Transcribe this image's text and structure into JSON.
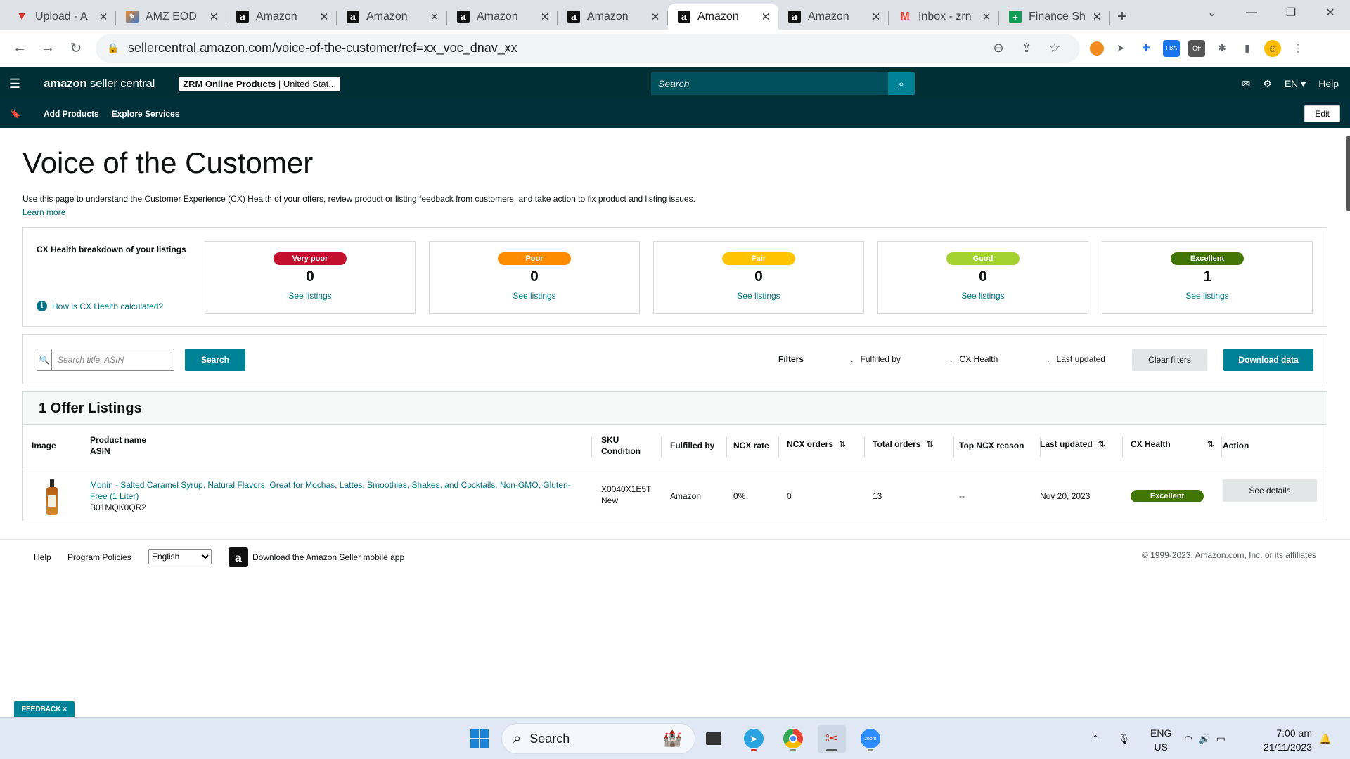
{
  "browser": {
    "tabs": [
      {
        "title": "Upload - A",
        "icon": "v-logo-icon",
        "active": false
      },
      {
        "title": "AMZ EOD",
        "icon": "amz-eod-icon",
        "active": false
      },
      {
        "title": "Amazon",
        "icon": "amazon-icon",
        "active": false
      },
      {
        "title": "Amazon",
        "icon": "amazon-icon",
        "active": false
      },
      {
        "title": "Amazon",
        "icon": "amazon-icon",
        "active": false
      },
      {
        "title": "Amazon",
        "icon": "amazon-icon",
        "active": false
      },
      {
        "title": "Amazon",
        "icon": "amazon-icon",
        "active": true
      },
      {
        "title": "Amazon",
        "icon": "amazon-icon",
        "active": false
      },
      {
        "title": "Inbox - zrn",
        "icon": "gmail-icon",
        "active": false
      },
      {
        "title": "Finance Sh",
        "icon": "sheets-icon",
        "active": false
      }
    ],
    "url": "sellercentral.amazon.com/voice-of-the-customer/ref=xx_voc_dnav_xx"
  },
  "header": {
    "logo_bold": "amazon",
    "logo_rest": " seller central",
    "account_bold": "ZRM Online Products",
    "account_rest": " | United Stat...",
    "search_placeholder": "Search",
    "language": "EN",
    "help": "Help"
  },
  "subnav": {
    "links": [
      "Add Products",
      "Explore Services"
    ],
    "edit": "Edit"
  },
  "page": {
    "title": "Voice of the Customer",
    "intro": "Use this page to understand the Customer Experience (CX) Health of your offers, review product or listing feedback from customers, and take action to fix product and listing issues.",
    "learn_more": "Learn more"
  },
  "cx_health": {
    "heading": "CX Health breakdown of your listings",
    "how_link": "How is CX Health calculated?",
    "cards": [
      {
        "label": "Very poor",
        "count": "0",
        "link": "See listings",
        "color": "#c40f2e"
      },
      {
        "label": "Poor",
        "count": "0",
        "link": "See listings",
        "color": "#ff8c00"
      },
      {
        "label": "Fair",
        "count": "0",
        "link": "See listings",
        "color": "#ffc400"
      },
      {
        "label": "Good",
        "count": "0",
        "link": "See listings",
        "color": "#a3d12f"
      },
      {
        "label": "Excellent",
        "count": "1",
        "link": "See listings",
        "color": "#417505"
      }
    ]
  },
  "filters": {
    "search_placeholder": "Search title, ASIN",
    "search_button": "Search",
    "filters_label": "Filters",
    "dropdowns": [
      "Fulfilled by",
      "CX Health",
      "Last updated"
    ],
    "clear": "Clear filters",
    "download": "Download data"
  },
  "listings": {
    "heading": "1 Offer Listings",
    "columns": {
      "image": "Image",
      "product_name": "Product name",
      "asin": "ASIN",
      "sku": "SKU",
      "condition": "Condition",
      "fulfilled_by": "Fulfilled by",
      "ncx_rate": "NCX rate",
      "ncx_orders": "NCX orders",
      "total_orders": "Total orders",
      "top_ncx_reason": "Top NCX reason",
      "last_updated": "Last updated",
      "cx_health": "CX Health",
      "action": "Action"
    },
    "rows": [
      {
        "product_name_1": "Monin - Salted Caramel Syrup, Natural Flavors, Great for Mochas, Lattes, Smoothies, Shakes, and Cocktails, Non-GMO, Gluten-",
        "product_name_2": "Free (1 Liter)",
        "asin": "B01MQK0QR2",
        "sku": "X0040X1E5T",
        "condition": "New",
        "fulfilled_by": "Amazon",
        "ncx_rate": "0%",
        "ncx_orders": "0",
        "total_orders": "13",
        "top_ncx_reason": "--",
        "last_updated": "Nov 20, 2023",
        "cx_health": "Excellent",
        "action": "See details"
      }
    ]
  },
  "footer": {
    "help": "Help",
    "program_policies": "Program Policies",
    "language_selected": "English",
    "app_link": "Download the Amazon Seller mobile app",
    "copyright": "© 1999-2023, Amazon.com, Inc. or its affiliates"
  },
  "feedback": "FEEDBACK ×",
  "taskbar": {
    "search": "Search",
    "lang_top": "ENG",
    "lang_bottom": "US",
    "time": "7:00 am",
    "date": "21/11/2023"
  }
}
